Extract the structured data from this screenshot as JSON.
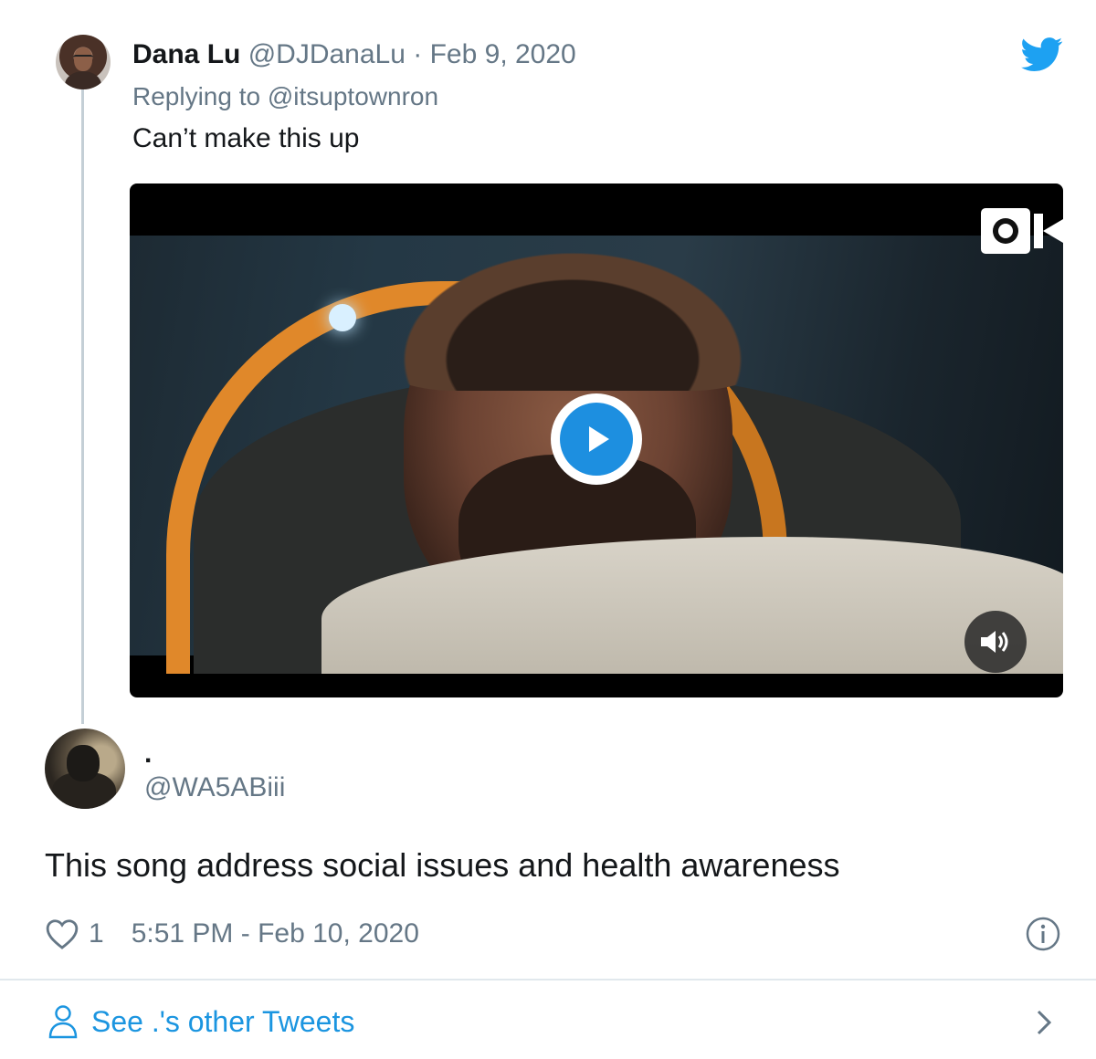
{
  "colors": {
    "twitter_blue": "#1da1f2",
    "link_blue": "#1b95e0",
    "muted_gray": "#657786",
    "text_dark": "#14171a"
  },
  "quoted_tweet": {
    "display_name": "Dana Lu",
    "handle": "@DJDanaLu",
    "separator": "·",
    "date": "Feb 9, 2020",
    "replying_to": "Replying to @itsuptownron",
    "text": "Can’t make this up",
    "icons": [
      "twitter-bird-icon",
      "play-icon",
      "volume-icon",
      "video-brand-icon"
    ]
  },
  "main_tweet": {
    "display_name": ".",
    "handle": "@WA5ABiii",
    "text": "This song address social issues and health awareness",
    "like_count": "1",
    "timestamp": "5:51 PM - Feb 10, 2020",
    "icons": [
      "heart-icon",
      "info-icon"
    ]
  },
  "footer": {
    "see_more_label": "See .'s other Tweets",
    "icons": [
      "person-icon",
      "chevron-right-icon"
    ]
  }
}
